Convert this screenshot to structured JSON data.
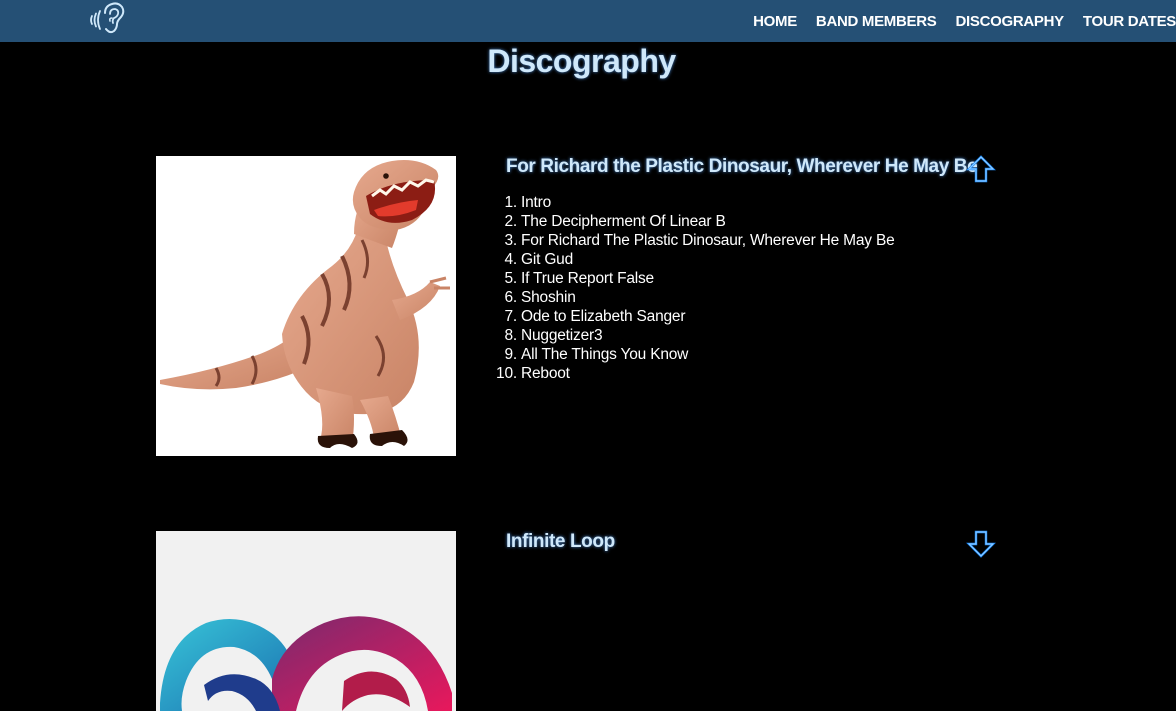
{
  "nav": {
    "logo_icon": "ear-sound-icon",
    "items": [
      "HOME",
      "BAND MEMBERS",
      "DISCOGRAPHY",
      "TOUR DATES"
    ]
  },
  "page": {
    "title": "Discography"
  },
  "albums": [
    {
      "title": "For Richard the Plastic Dinosaur, Wherever He May Be",
      "cover_icon": "dinosaur-image",
      "toggle_icon": "arrow-up-icon",
      "tracks": [
        {
          "num": "1.",
          "name": "Intro"
        },
        {
          "num": "2.",
          "name": "The Decipherment Of Linear B"
        },
        {
          "num": "3.",
          "name": "For Richard The Plastic Dinosaur, Wherever He May Be"
        },
        {
          "num": "4.",
          "name": "Git Gud"
        },
        {
          "num": "5.",
          "name": "If True Report False"
        },
        {
          "num": "6.",
          "name": "Shoshin"
        },
        {
          "num": "7.",
          "name": "Ode to Elizabeth Sanger"
        },
        {
          "num": "8.",
          "name": "Nuggetizer3"
        },
        {
          "num": "9.",
          "name": "All The Things You Know"
        },
        {
          "num": "10.",
          "name": "Reboot"
        }
      ]
    },
    {
      "title": "Infinite Loop",
      "cover_icon": "infinity-logo-image",
      "toggle_icon": "arrow-down-icon"
    }
  ],
  "colors": {
    "navbar": "#255075",
    "background": "#000000",
    "heading": "#cfe8fa",
    "accent": "#1e8fff"
  }
}
